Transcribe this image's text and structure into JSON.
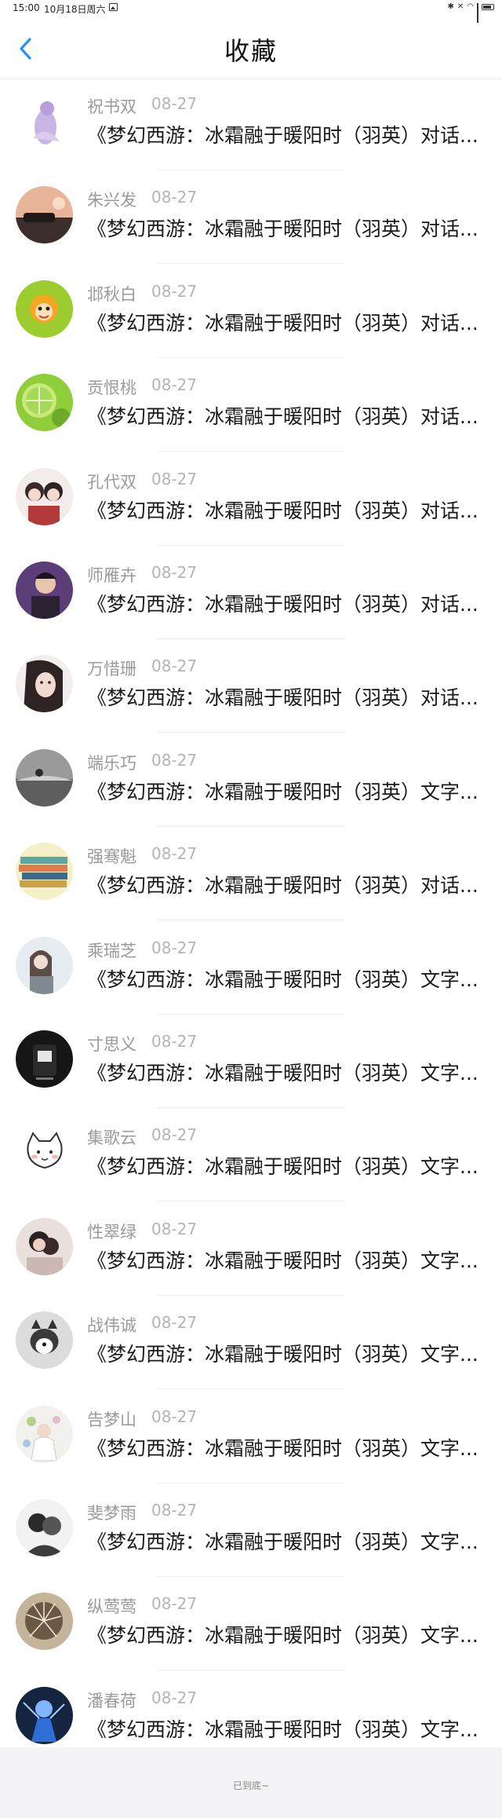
{
  "status_bar": {
    "time": "15:00",
    "date": "10月18日周六"
  },
  "header": {
    "title": "收藏"
  },
  "favorites": [
    {
      "name": "祝书双",
      "date": "08-27",
      "title": "《梦幻西游：冰霜融于暖阳时（羽英）对话...",
      "avatar": "anime-girl-purple-avatar"
    },
    {
      "name": "朱兴发",
      "date": "08-27",
      "title": "《梦幻西游：冰霜融于暖阳时（羽英）对话...",
      "avatar": "sunset-car-avatar"
    },
    {
      "name": "邶秋白",
      "date": "08-27",
      "title": "《梦幻西游：冰霜融于暖阳时（羽英）对话...",
      "avatar": "cartoon-monkey-avatar"
    },
    {
      "name": "贡恨桃",
      "date": "08-27",
      "title": "《梦幻西游：冰霜融于暖阳时（羽英）对话...",
      "avatar": "lime-slice-avatar"
    },
    {
      "name": "孔代双",
      "date": "08-27",
      "title": "《梦幻西游：冰霜融于暖阳时（羽英）对话...",
      "avatar": "anime-couple-avatar"
    },
    {
      "name": "师雁卉",
      "date": "08-27",
      "title": "《梦幻西游：冰霜融于暖阳时（羽英）对话...",
      "avatar": "young-man-avatar"
    },
    {
      "name": "万惜珊",
      "date": "08-27",
      "title": "《梦幻西游：冰霜融于暖阳时（羽英）对话...",
      "avatar": "woman-portrait-avatar"
    },
    {
      "name": "端乐巧",
      "date": "08-27",
      "title": "《梦幻西游：冰霜融于暖阳时（羽英）文字...",
      "avatar": "grey-landscape-avatar"
    },
    {
      "name": "强骞魁",
      "date": "08-27",
      "title": "《梦幻西游：冰霜融于暖阳时（羽英）对话...",
      "avatar": "stacked-books-avatar"
    },
    {
      "name": "乘瑞芝",
      "date": "08-27",
      "title": "《梦幻西游：冰霜融于暖阳时（羽英）文字...",
      "avatar": "girl-winter-avatar"
    },
    {
      "name": "寸思义",
      "date": "08-27",
      "title": "《梦幻西游：冰霜融于暖阳时（羽英）文字...",
      "avatar": "dark-figure-avatar"
    },
    {
      "name": "集歌云",
      "date": "08-27",
      "title": "《梦幻西游：冰霜融于暖阳时（羽英）文字...",
      "avatar": "cartoon-cat-avatar"
    },
    {
      "name": "性翠绿",
      "date": "08-27",
      "title": "《梦幻西游：冰霜融于暖阳时（羽英）文字...",
      "avatar": "couple-photo-avatar"
    },
    {
      "name": "战伟诚",
      "date": "08-27",
      "title": "《梦幻西游：冰霜融于暖阳时（羽英）文字...",
      "avatar": "husky-dog-avatar"
    },
    {
      "name": "告梦山",
      "date": "08-27",
      "title": "《梦幻西游：冰霜融于暖阳时（羽英）文字...",
      "avatar": "flower-girl-avatar"
    },
    {
      "name": "斐梦雨",
      "date": "08-27",
      "title": "《梦幻西游：冰霜融于暖阳时（羽英）文字...",
      "avatar": "mono-couple-avatar"
    },
    {
      "name": "纵莺莺",
      "date": "08-27",
      "title": "《梦幻西游：冰霜融于暖阳时（羽英）文字...",
      "avatar": "dandelion-avatar"
    },
    {
      "name": "潘春荷",
      "date": "08-27",
      "title": "《梦幻西游：冰霜融于暖阳时（羽英）文字...",
      "avatar": "blue-hero-avatar"
    }
  ],
  "footer": {
    "text": "已到底~"
  },
  "colors": {
    "accent": "#2f8ff0",
    "name": "#9a9a9a",
    "date": "#b4b4b4",
    "title": "#1a1a1a",
    "footer_bg": "#f3f3f5"
  }
}
